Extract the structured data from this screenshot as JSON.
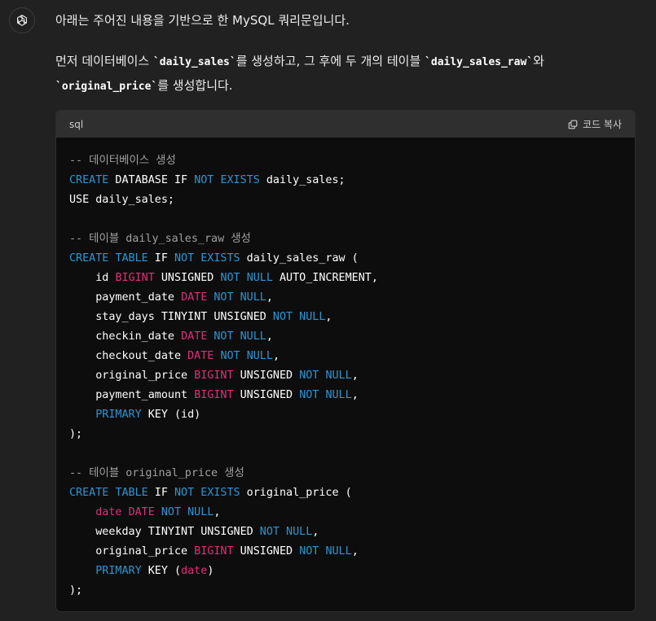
{
  "assistant": {
    "avatar_icon": "openai-logo-icon"
  },
  "message": {
    "line1": "아래는 주어진 내용을 기반으로 한 MySQL 쿼리문입니다.",
    "para2": {
      "t1": "먼저 데이터베이스 ",
      "c1": "`daily_sales`",
      "t2": "를 생성하고, 그 후에 두 개의 테이블 ",
      "c2": "`daily_sales_raw`",
      "t3": "와",
      "c3": "`original_price`",
      "t4": "를 생성합니다."
    }
  },
  "code_block": {
    "language": "sql",
    "copy_label": "코드 복사",
    "copy_icon": "copy-icon",
    "lines": [
      [
        {
          "t": "cm",
          "v": "-- 데이터베이스 생성"
        }
      ],
      [
        {
          "t": "kw",
          "v": "CREATE"
        },
        {
          "t": "pl",
          "v": " DATABASE IF "
        },
        {
          "t": "kw",
          "v": "NOT"
        },
        {
          "t": "pl",
          "v": " "
        },
        {
          "t": "kw",
          "v": "EXISTS"
        },
        {
          "t": "pl",
          "v": " daily_sales;"
        }
      ],
      [
        {
          "t": "pl",
          "v": "USE daily_sales;"
        }
      ],
      [],
      [
        {
          "t": "cm",
          "v": "-- 테이블 daily_sales_raw 생성"
        }
      ],
      [
        {
          "t": "kw",
          "v": "CREATE"
        },
        {
          "t": "pl",
          "v": " "
        },
        {
          "t": "kw",
          "v": "TABLE"
        },
        {
          "t": "pl",
          "v": " IF "
        },
        {
          "t": "kw",
          "v": "NOT"
        },
        {
          "t": "pl",
          "v": " "
        },
        {
          "t": "kw",
          "v": "EXISTS"
        },
        {
          "t": "pl",
          "v": " daily_sales_raw ("
        }
      ],
      [
        {
          "t": "pl",
          "v": "    id "
        },
        {
          "t": "type",
          "v": "BIGINT"
        },
        {
          "t": "pl",
          "v": " UNSIGNED "
        },
        {
          "t": "kw",
          "v": "NOT"
        },
        {
          "t": "pl",
          "v": " "
        },
        {
          "t": "kw",
          "v": "NULL"
        },
        {
          "t": "pl",
          "v": " AUTO_INCREMENT,"
        }
      ],
      [
        {
          "t": "pl",
          "v": "    payment_date "
        },
        {
          "t": "type",
          "v": "DATE"
        },
        {
          "t": "pl",
          "v": " "
        },
        {
          "t": "kw",
          "v": "NOT"
        },
        {
          "t": "pl",
          "v": " "
        },
        {
          "t": "kw",
          "v": "NULL"
        },
        {
          "t": "pl",
          "v": ","
        }
      ],
      [
        {
          "t": "pl",
          "v": "    stay_days TINYINT UNSIGNED "
        },
        {
          "t": "kw",
          "v": "NOT"
        },
        {
          "t": "pl",
          "v": " "
        },
        {
          "t": "kw",
          "v": "NULL"
        },
        {
          "t": "pl",
          "v": ","
        }
      ],
      [
        {
          "t": "pl",
          "v": "    checkin_date "
        },
        {
          "t": "type",
          "v": "DATE"
        },
        {
          "t": "pl",
          "v": " "
        },
        {
          "t": "kw",
          "v": "NOT"
        },
        {
          "t": "pl",
          "v": " "
        },
        {
          "t": "kw",
          "v": "NULL"
        },
        {
          "t": "pl",
          "v": ","
        }
      ],
      [
        {
          "t": "pl",
          "v": "    checkout_date "
        },
        {
          "t": "type",
          "v": "DATE"
        },
        {
          "t": "pl",
          "v": " "
        },
        {
          "t": "kw",
          "v": "NOT"
        },
        {
          "t": "pl",
          "v": " "
        },
        {
          "t": "kw",
          "v": "NULL"
        },
        {
          "t": "pl",
          "v": ","
        }
      ],
      [
        {
          "t": "pl",
          "v": "    original_price "
        },
        {
          "t": "type",
          "v": "BIGINT"
        },
        {
          "t": "pl",
          "v": " UNSIGNED "
        },
        {
          "t": "kw",
          "v": "NOT"
        },
        {
          "t": "pl",
          "v": " "
        },
        {
          "t": "kw",
          "v": "NULL"
        },
        {
          "t": "pl",
          "v": ","
        }
      ],
      [
        {
          "t": "pl",
          "v": "    payment_amount "
        },
        {
          "t": "type",
          "v": "BIGINT"
        },
        {
          "t": "pl",
          "v": " UNSIGNED "
        },
        {
          "t": "kw",
          "v": "NOT"
        },
        {
          "t": "pl",
          "v": " "
        },
        {
          "t": "kw",
          "v": "NULL"
        },
        {
          "t": "pl",
          "v": ","
        }
      ],
      [
        {
          "t": "pl",
          "v": "    "
        },
        {
          "t": "kw",
          "v": "PRIMARY"
        },
        {
          "t": "pl",
          "v": " KEY (id)"
        }
      ],
      [
        {
          "t": "pl",
          "v": ");"
        }
      ],
      [],
      [
        {
          "t": "cm",
          "v": "-- 테이블 original_price 생성"
        }
      ],
      [
        {
          "t": "kw",
          "v": "CREATE"
        },
        {
          "t": "pl",
          "v": " "
        },
        {
          "t": "kw",
          "v": "TABLE"
        },
        {
          "t": "pl",
          "v": " IF "
        },
        {
          "t": "kw",
          "v": "NOT"
        },
        {
          "t": "pl",
          "v": " "
        },
        {
          "t": "kw",
          "v": "EXISTS"
        },
        {
          "t": "pl",
          "v": " original_price ("
        }
      ],
      [
        {
          "t": "pl",
          "v": "    "
        },
        {
          "t": "type",
          "v": "date"
        },
        {
          "t": "pl",
          "v": " "
        },
        {
          "t": "type",
          "v": "DATE"
        },
        {
          "t": "pl",
          "v": " "
        },
        {
          "t": "kw",
          "v": "NOT"
        },
        {
          "t": "pl",
          "v": " "
        },
        {
          "t": "kw",
          "v": "NULL"
        },
        {
          "t": "pl",
          "v": ","
        }
      ],
      [
        {
          "t": "pl",
          "v": "    weekday TINYINT UNSIGNED "
        },
        {
          "t": "kw",
          "v": "NOT"
        },
        {
          "t": "pl",
          "v": " "
        },
        {
          "t": "kw",
          "v": "NULL"
        },
        {
          "t": "pl",
          "v": ","
        }
      ],
      [
        {
          "t": "pl",
          "v": "    original_price "
        },
        {
          "t": "type",
          "v": "BIGINT"
        },
        {
          "t": "pl",
          "v": " UNSIGNED "
        },
        {
          "t": "kw",
          "v": "NOT"
        },
        {
          "t": "pl",
          "v": " "
        },
        {
          "t": "kw",
          "v": "NULL"
        },
        {
          "t": "pl",
          "v": ","
        }
      ],
      [
        {
          "t": "pl",
          "v": "    "
        },
        {
          "t": "kw",
          "v": "PRIMARY"
        },
        {
          "t": "pl",
          "v": " KEY ("
        },
        {
          "t": "type",
          "v": "date"
        },
        {
          "t": "pl",
          "v": ")"
        }
      ],
      [
        {
          "t": "pl",
          "v": ");"
        }
      ]
    ]
  },
  "colors": {
    "background": "#212121",
    "code_background": "#0d0d0d",
    "code_header": "#2f2f2f",
    "keyword": "#2e95d3",
    "type": "#df3079",
    "comment": "#a0a0a0"
  }
}
